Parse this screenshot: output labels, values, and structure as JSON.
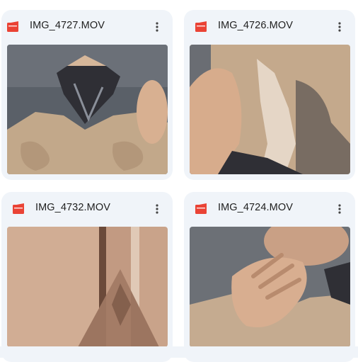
{
  "files": [
    {
      "name": "IMG_4727.MOV",
      "icon": "video-file-icon",
      "menu_icon": "more-vert-icon"
    },
    {
      "name": "IMG_4726.MOV",
      "icon": "video-file-icon",
      "menu_icon": "more-vert-icon"
    },
    {
      "name": "IMG_4732.MOV",
      "icon": "video-file-icon",
      "menu_icon": "more-vert-icon"
    },
    {
      "name": "IMG_4724.MOV",
      "icon": "video-file-icon",
      "menu_icon": "more-vert-icon"
    }
  ],
  "colors": {
    "card_background": "#f0f4f9",
    "video_icon": "#ea4335",
    "text": "#1f1f1f"
  }
}
